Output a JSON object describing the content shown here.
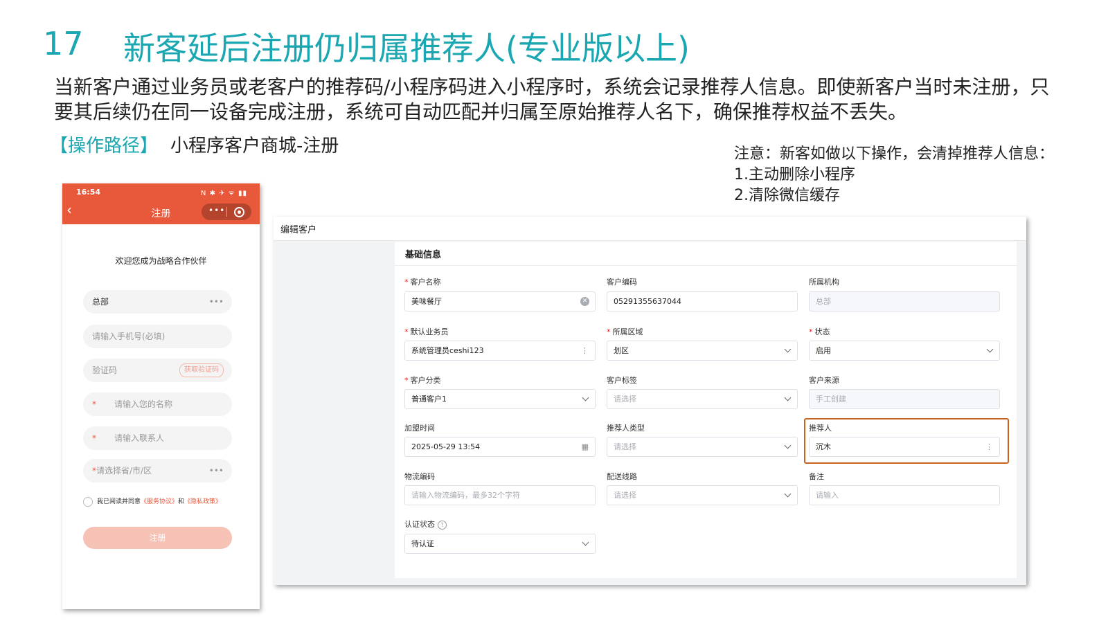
{
  "slide": {
    "number": "17",
    "title": "新客延后注册仍归属推荐人(专业版以上)",
    "description": "当新客户通过业务员或老客户的推荐码/小程序码进入小程序时，系统会记录推荐人信息。即使新客户当时未注册，只要其后续仍在同一设备完成注册，系统可自动匹配并归属至原始推荐人名下，确保推荐权益不丢失。",
    "path_tag": "【操作路径】",
    "path_value": "小程序客户商城-注册",
    "note": {
      "title": "注意：新客如做以下操作，会清掉推荐人信息：",
      "items": [
        "1.主动删除小程序",
        "2.清除微信缓存"
      ]
    }
  },
  "phone": {
    "status_time": "16:54",
    "status_icons": "N ✱ ✈ ᯤ ▮▮",
    "back_icon": "chevron-left-icon",
    "nav_title": "注册",
    "welcome": "欢迎您成为战略合作伙伴",
    "org_value": "总部",
    "phone_placeholder": "请输入手机号(必填)",
    "code_placeholder": "验证码",
    "code_button": "获取验证码",
    "name_placeholder": "请输入您的名称",
    "contact_placeholder": "请输入联系人",
    "region_placeholder": "请选择省/市/区",
    "required_mark": "*",
    "more_dots": "•••",
    "agree_prefix": "我已阅读并同意",
    "service_link": "《服务协议》",
    "and_text": "和",
    "privacy_link": "《隐私政策》",
    "submit_label": "注册",
    "brand_color": "#e8583a"
  },
  "panel": {
    "title": "编辑客户",
    "section_title": "基础信息",
    "fields": {
      "customer_name": {
        "label": "客户名称",
        "value": "美味餐厅",
        "required": true
      },
      "customer_code": {
        "label": "客户编码",
        "value": "05291355637044"
      },
      "organization": {
        "label": "所属机构",
        "value": "总部"
      },
      "salesperson": {
        "label": "默认业务员",
        "value": "系统管理员ceshi123",
        "required": true
      },
      "region": {
        "label": "所属区域",
        "value": "划区",
        "required": true
      },
      "status": {
        "label": "状态",
        "value": "启用",
        "required": true
      },
      "category": {
        "label": "客户分类",
        "value": "普通客户1",
        "required": true
      },
      "tags": {
        "label": "客户标签",
        "placeholder": "请选择"
      },
      "source": {
        "label": "客户来源",
        "value": "手工创建"
      },
      "join_time": {
        "label": "加盟时间",
        "value": "2025-05-29 13:54"
      },
      "referrer_type": {
        "label": "推荐人类型",
        "placeholder": "请选择"
      },
      "referrer": {
        "label": "推荐人",
        "value": "沉木"
      },
      "logistics_code": {
        "label": "物流编码",
        "placeholder": "请输入物流编码，最多32个字符"
      },
      "delivery_route": {
        "label": "配送线路",
        "placeholder": "请选择"
      },
      "remark": {
        "label": "备注",
        "placeholder": "请输入"
      },
      "auth_status": {
        "label": "认证状态",
        "value": "待认证"
      }
    },
    "required_mark": "*",
    "ellipsis": "⋮",
    "highlight_color": "#c8621e"
  }
}
